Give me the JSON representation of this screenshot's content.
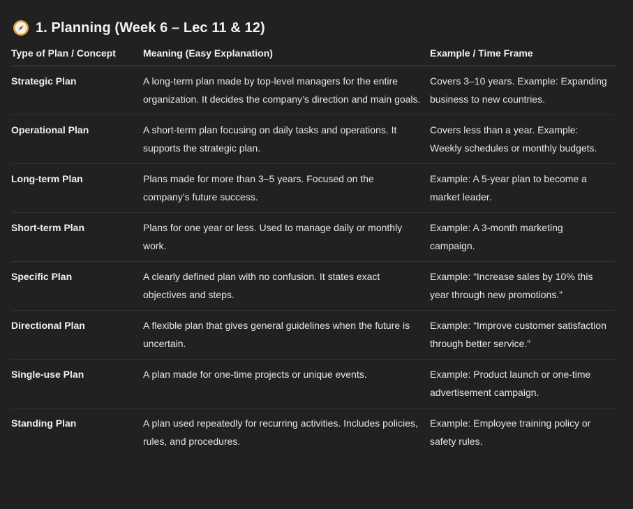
{
  "heading": {
    "icon": "compass-icon",
    "title": "1. Planning (Week 6 – Lec 11 & 12)"
  },
  "table": {
    "headers": [
      "Type of Plan / Concept",
      "Meaning (Easy Explanation)",
      "Example / Time Frame"
    ],
    "rows": [
      {
        "concept": "Strategic Plan",
        "meaning": "A long-term plan made by top-level managers for the entire organization. It decides the company’s direction and main goals.",
        "example": "Covers 3–10 years. Example: Expanding business to new countries."
      },
      {
        "concept": "Operational Plan",
        "meaning": "A short-term plan focusing on daily tasks and operations. It supports the strategic plan.",
        "example": "Covers less than a year. Example: Weekly schedules or monthly budgets."
      },
      {
        "concept": "Long-term Plan",
        "meaning": "Plans made for more than 3–5 years. Focused on the company’s future success.",
        "example": "Example: A 5-year plan to become a market leader."
      },
      {
        "concept": "Short-term Plan",
        "meaning": "Plans for one year or less. Used to manage daily or monthly work.",
        "example": "Example: A 3-month marketing campaign."
      },
      {
        "concept": "Specific Plan",
        "meaning": "A clearly defined plan with no confusion. It states exact objectives and steps.",
        "example": "Example: “Increase sales by 10% this year through new promotions.”"
      },
      {
        "concept": "Directional Plan",
        "meaning": "A flexible plan that gives general guidelines when the future is uncertain.",
        "example": "Example: “Improve customer satisfaction through better service.”"
      },
      {
        "concept": "Single-use Plan",
        "meaning": "A plan made for one-time projects or unique events.",
        "example": "Example: Product launch or one-time advertisement campaign."
      },
      {
        "concept": "Standing Plan",
        "meaning": "A plan used repeatedly for recurring activities. Includes policies, rules, and procedures.",
        "example": "Example: Employee training policy or safety rules."
      }
    ]
  }
}
